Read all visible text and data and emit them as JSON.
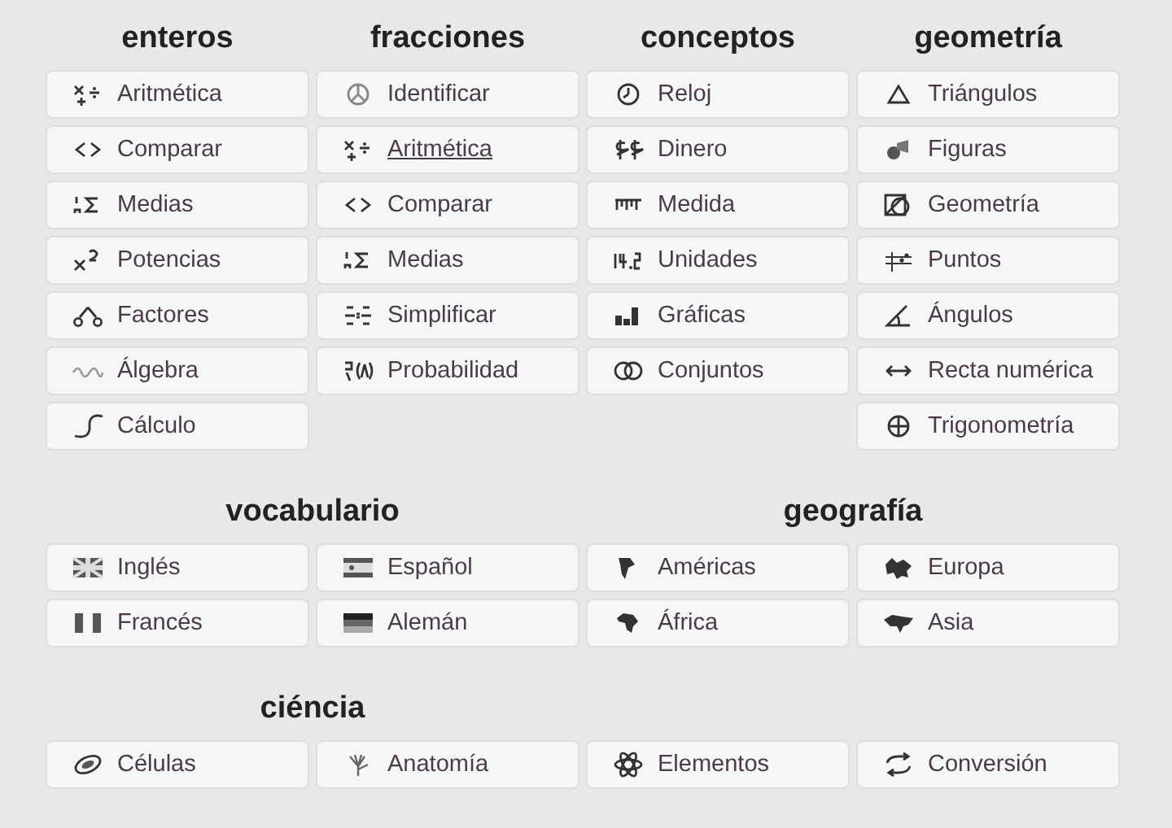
{
  "sections": [
    {
      "groups": [
        {
          "heading": "enteros",
          "items": [
            {
              "label": "Aritmética",
              "hovered": false
            },
            {
              "label": "Comparar",
              "hovered": false
            },
            {
              "label": "Medias",
              "hovered": false
            },
            {
              "label": "Potencias",
              "hovered": false
            },
            {
              "label": "Factores",
              "hovered": false
            },
            {
              "label": "Álgebra",
              "hovered": false
            },
            {
              "label": "Cálculo",
              "hovered": false
            }
          ]
        },
        {
          "heading": "fracciones",
          "items": [
            {
              "label": "Identificar",
              "hovered": false
            },
            {
              "label": "Aritmética",
              "hovered": true
            },
            {
              "label": "Comparar",
              "hovered": false
            },
            {
              "label": "Medias",
              "hovered": false
            },
            {
              "label": "Simplificar",
              "hovered": false
            },
            {
              "label": "Probabilidad",
              "hovered": false
            }
          ]
        },
        {
          "heading": "conceptos",
          "items": [
            {
              "label": "Reloj",
              "hovered": false
            },
            {
              "label": "Dinero",
              "hovered": false
            },
            {
              "label": "Medida",
              "hovered": false
            },
            {
              "label": "Unidades",
              "hovered": false
            },
            {
              "label": "Gráficas",
              "hovered": false
            },
            {
              "label": "Conjuntos",
              "hovered": false
            }
          ]
        },
        {
          "heading": "geometría",
          "items": [
            {
              "label": "Triángulos",
              "hovered": false
            },
            {
              "label": "Figuras",
              "hovered": false
            },
            {
              "label": "Geometría",
              "hovered": false
            },
            {
              "label": "Puntos",
              "hovered": false
            },
            {
              "label": "Ángulos",
              "hovered": false
            },
            {
              "label": "Recta numérica",
              "hovered": false
            },
            {
              "label": "Trigonometría",
              "hovered": false
            }
          ]
        }
      ]
    },
    {
      "groups": [
        {
          "heading": "vocabulario",
          "items": [
            {
              "label": "Inglés",
              "hovered": false
            },
            {
              "label": "Español",
              "hovered": false
            },
            {
              "label": "Francés",
              "hovered": false
            },
            {
              "label": "Alemán",
              "hovered": false
            }
          ]
        },
        {
          "heading": "geografía",
          "items": [
            {
              "label": "Américas",
              "hovered": false
            },
            {
              "label": "Europa",
              "hovered": false
            },
            {
              "label": "África",
              "hovered": false
            },
            {
              "label": "Asia",
              "hovered": false
            }
          ]
        }
      ]
    },
    {
      "groups": [
        {
          "heading": "ciéncia",
          "items": [
            {
              "label": "Células",
              "hovered": false
            },
            {
              "label": "Anatomía",
              "hovered": false
            },
            {
              "label": "Elementos",
              "hovered": false
            },
            {
              "label": "Conversión",
              "hovered": false
            }
          ]
        }
      ]
    }
  ]
}
